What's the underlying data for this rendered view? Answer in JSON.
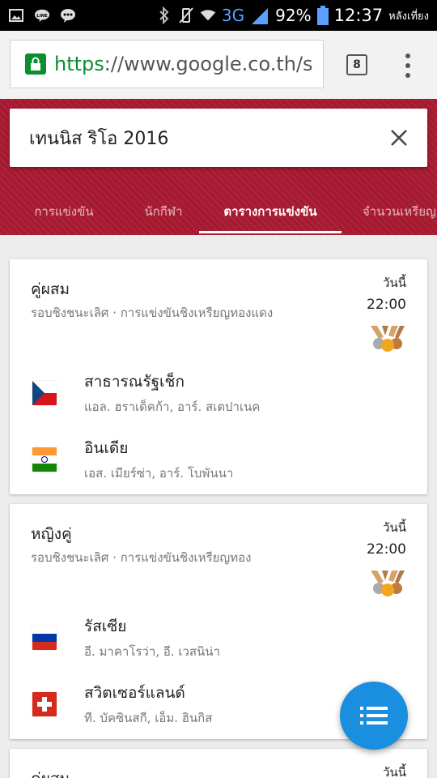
{
  "status_bar": {
    "network": "3G",
    "battery_percent": "92%",
    "time": "12:37",
    "time_period": "หลังเที่ยง",
    "icons": [
      "gallery-icon",
      "line-app-icon",
      "messenger-icon",
      "bluetooth-icon",
      "vibrate-icon",
      "wifi-icon",
      "signal-icon",
      "battery-icon"
    ]
  },
  "browser": {
    "url_scheme": "https",
    "url_rest": "://www.google.co.th/s",
    "tab_count": "8"
  },
  "search": {
    "query": "เทนนิส ริโอ 2016"
  },
  "tabs": [
    {
      "label": "การแข่งขัน"
    },
    {
      "label": "นักกีฬา"
    },
    {
      "label": "ตารางการแข่งขัน"
    },
    {
      "label": "จำนวนเหรียญ"
    }
  ],
  "events": [
    {
      "title": "คู่ผสม",
      "subtitle": "รอบชิงชนะเลิศ · การแข่งขันชิงเหรียญทองแดง",
      "day": "วันนี้",
      "time": "22:00",
      "teams": [
        {
          "name": "สาธารณรัฐเช็ก",
          "players": "แอล. ฮราเด็คก้า, อาร์. สเตปาเนค",
          "flag": "czech"
        },
        {
          "name": "อินเดีย",
          "players": "เอส. เมียร์ซ่า, อาร์. โบพันนา",
          "flag": "india"
        }
      ]
    },
    {
      "title": "หญิงคู่",
      "subtitle": "รอบชิงชนะเลิศ · การแข่งขันชิงเหรียญทอง",
      "day": "วันนี้",
      "time": "22:00",
      "teams": [
        {
          "name": "รัสเซีย",
          "players": "อี. มาคาโรว่า, อี. เวสนิน่า",
          "flag": "russia"
        },
        {
          "name": "สวิตเซอร์แลนด์",
          "players": "ที. บัคซินสกี, เอ็ม. ฮินกิส",
          "flag": "switzerland"
        }
      ]
    },
    {
      "title": "คู่ผสม",
      "day": "วันนี้"
    }
  ],
  "colors": {
    "header_maroon": "#a81a32",
    "fab_blue": "#1a8fe0",
    "secure_green": "#0b8f2e"
  }
}
